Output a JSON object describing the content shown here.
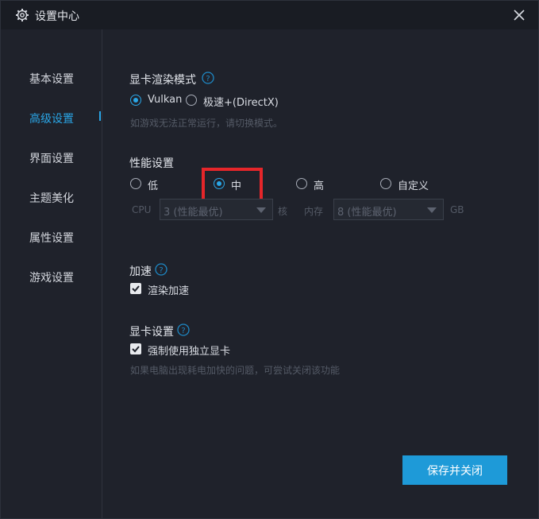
{
  "window": {
    "title": "设置中心"
  },
  "sidebar": {
    "items": [
      {
        "label": "基本设置"
      },
      {
        "label": "高级设置",
        "active": true
      },
      {
        "label": "界面设置"
      },
      {
        "label": "主题美化"
      },
      {
        "label": "属性设置"
      },
      {
        "label": "游戏设置"
      }
    ]
  },
  "render_mode": {
    "title": "显卡渲染模式",
    "options": [
      "Vulkan",
      "极速+(DirectX)"
    ],
    "selected": "Vulkan",
    "hint": "如游戏无法正常运行，请切换模式。"
  },
  "performance": {
    "title": "性能设置",
    "options": [
      "低",
      "中",
      "高",
      "自定义"
    ],
    "selected": "中",
    "cpu_label": "CPU",
    "cpu_value": "3 (性能最优)",
    "cpu_unit": "核",
    "mem_label": "内存",
    "mem_value": "8 (性能最优)",
    "mem_unit": "GB"
  },
  "acceleration": {
    "title": "加速",
    "checkbox_label": "渲染加速",
    "checked": true
  },
  "gpu": {
    "title": "显卡设置",
    "checkbox_label": "强制使用独立显卡",
    "checked": true,
    "hint": "如果电脑出现耗电加快的问题，可尝试关闭该功能"
  },
  "footer": {
    "save_label": "保存并关闭"
  },
  "colors": {
    "accent": "#1e9ad8",
    "highlight": "#e5262a",
    "background": "#1f222b"
  }
}
